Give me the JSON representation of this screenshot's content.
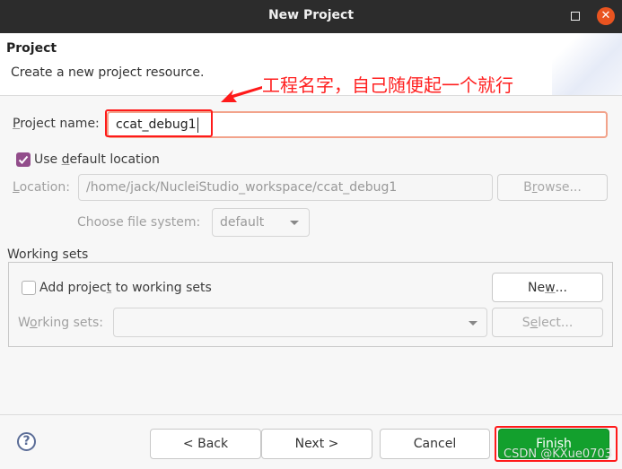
{
  "window": {
    "title": "New Project",
    "maximize_icon": "maximize-icon",
    "close_glyph": "✕"
  },
  "header": {
    "title": "Project",
    "description": "Create a new project resource.",
    "banner_icon": "open-folder-icon"
  },
  "annotation": {
    "text": "工程名字，自己随便起一个就行",
    "color": "#ff2020"
  },
  "form": {
    "project_name_label_pre": "",
    "project_name_label_mn": "P",
    "project_name_label_post": "roject name:",
    "project_name_value": "ccat_debug1",
    "use_default_location": {
      "label_pre": "Use ",
      "label_mn": "d",
      "label_post": "efault location",
      "checked": true
    },
    "location_label_mn": "L",
    "location_label_post": "ocation:",
    "location_value": "/home/jack/NucleiStudio_workspace/ccat_debug1",
    "browse_pre": "B",
    "browse_mn": "r",
    "browse_post": "owse...",
    "file_system_label": "Choose file system:",
    "file_system_value": "default"
  },
  "working_sets": {
    "group_label": "Working sets",
    "add_checkbox": {
      "label_pre": "Add projec",
      "label_mn": "t",
      "label_post": " to working sets",
      "checked": false
    },
    "new_pre": "Ne",
    "new_mn": "w",
    "new_post": "...",
    "sets_label_pre": "W",
    "sets_label_mn": "o",
    "sets_label_post": "rking sets:",
    "sets_value": "",
    "select_pre": "S",
    "select_mn": "e",
    "select_post": "lect..."
  },
  "footer": {
    "help_glyph": "?",
    "back": "< Back",
    "next": "Next >",
    "cancel": "Cancel",
    "finish": "Finish",
    "finish_color": "#13a02d"
  },
  "watermark": "CSDN @KXue0703"
}
